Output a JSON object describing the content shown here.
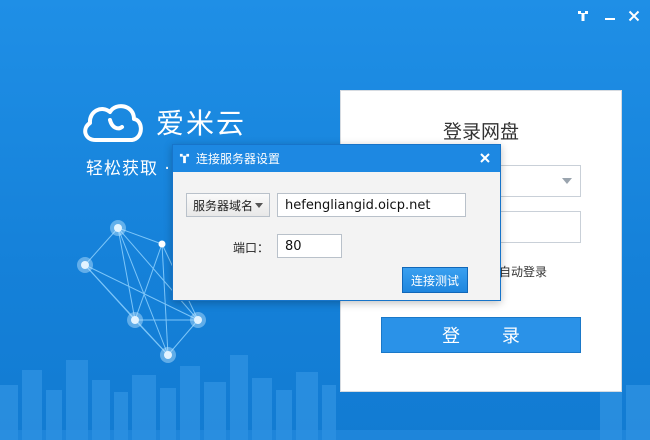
{
  "app": {
    "brand_name": "爱米云",
    "slogan": "轻松获取 · "
  },
  "login": {
    "title": "登录网盘",
    "auto_login_label": "自动登录",
    "login_button_label": "登 录"
  },
  "dialog": {
    "title": "连接服务器设置",
    "server_type_selected": "服务器域名",
    "domain_value": "hefengliangid.oicp.net",
    "port_label": "端口：",
    "port_value": "80",
    "test_button_label": "连接测试"
  },
  "icons": {
    "settings": "wrench-icon",
    "minimize": "minimize-icon",
    "close": "close-icon",
    "logo": "cloud-logo-icon"
  },
  "colors": {
    "background": "#1581d9",
    "accent": "#2a92e8",
    "dialog_titlebar": "#1d88e2"
  }
}
